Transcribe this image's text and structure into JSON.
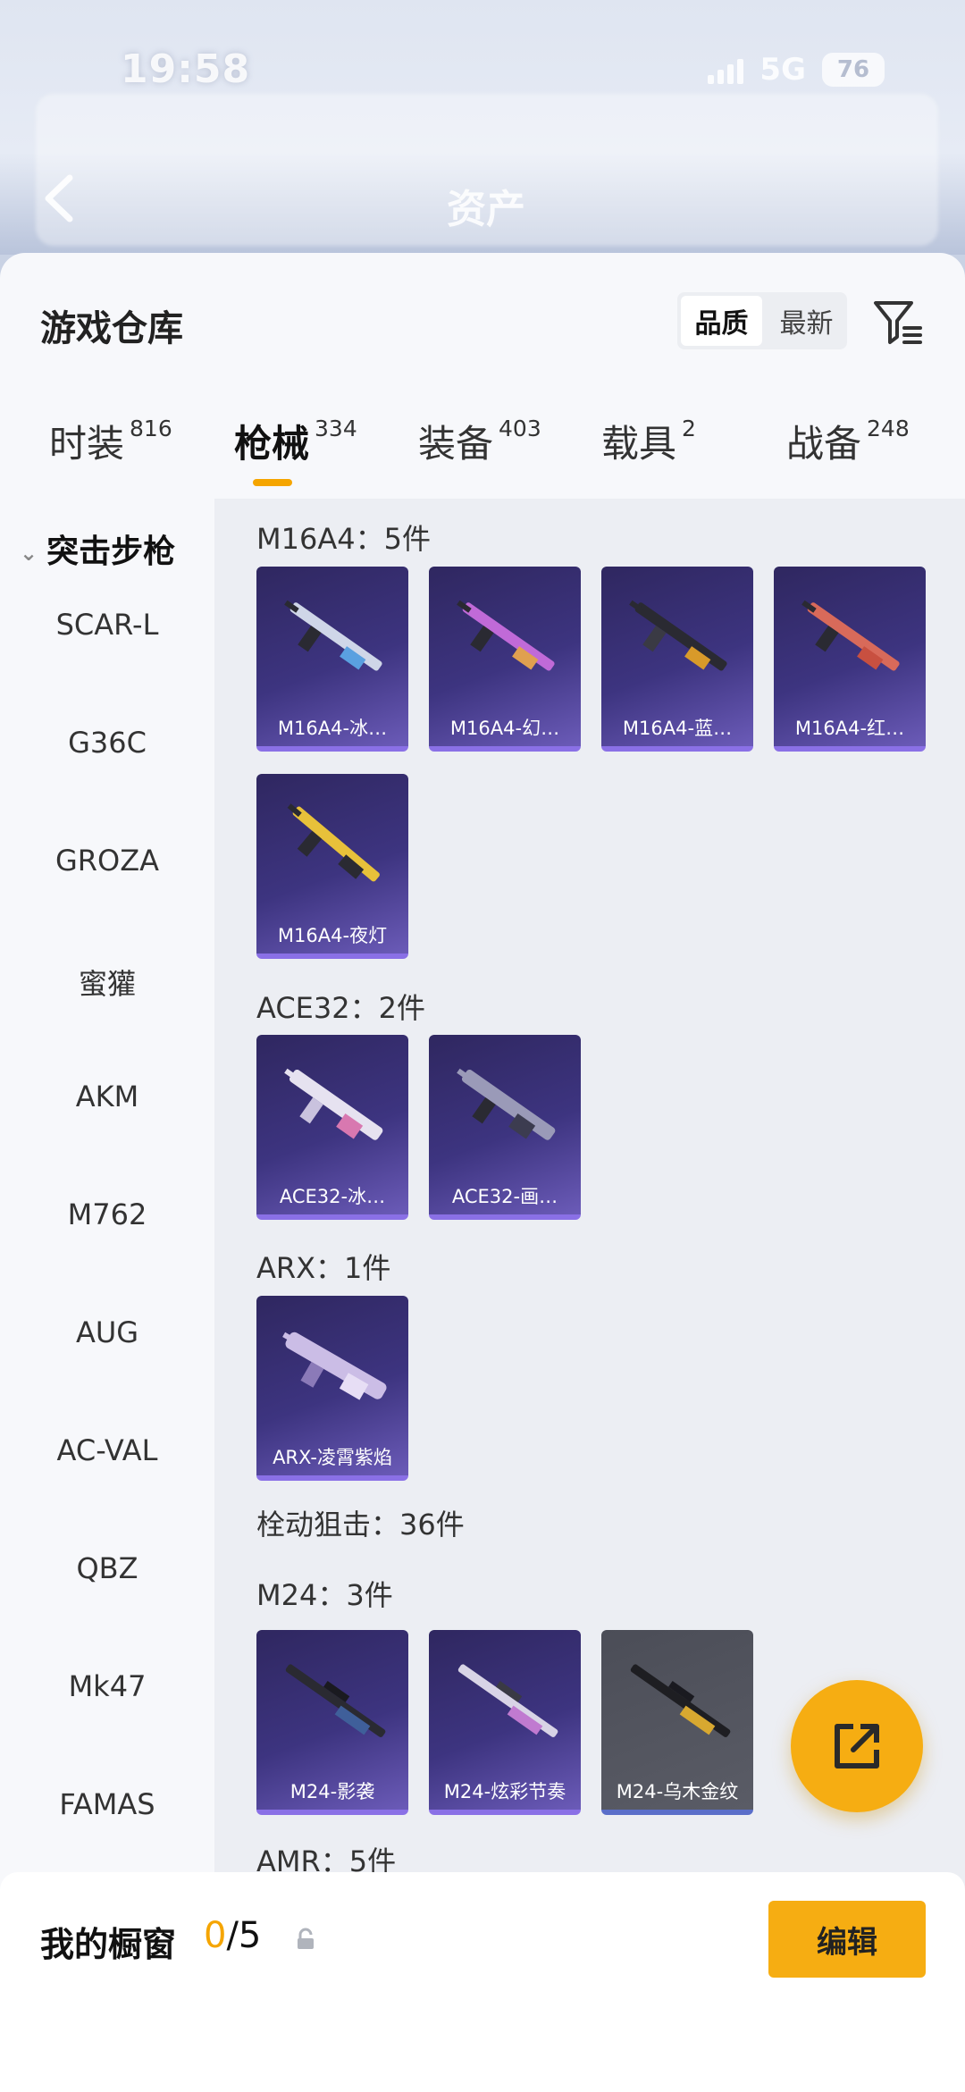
{
  "status": {
    "time": "19:58",
    "network": "5G",
    "battery": "76"
  },
  "header": {
    "title": "资产"
  },
  "panel": {
    "title": "游戏仓库",
    "sort": {
      "options": [
        "品质",
        "最新"
      ],
      "selected": "品质"
    }
  },
  "tabs": [
    {
      "label": "时装",
      "count": "816"
    },
    {
      "label": "枪械",
      "count": "334"
    },
    {
      "label": "装备",
      "count": "403"
    },
    {
      "label": "载具",
      "count": "2"
    },
    {
      "label": "战备",
      "count": "248"
    }
  ],
  "sidebar": {
    "items": [
      "突击步枪",
      "SCAR-L",
      "G36C",
      "GROZA",
      "蜜獾",
      "AKM",
      "M762",
      "AUG",
      "AC-VAL",
      "QBZ",
      "Mk47",
      "FAMAS"
    ]
  },
  "content": {
    "groups": [
      {
        "title": "M16A4：5件",
        "items": [
          "M16A4-冰…",
          "M16A4-幻…",
          "M16A4-蓝…",
          "M16A4-红…",
          "M16A4-夜灯"
        ]
      },
      {
        "title": "ACE32：2件",
        "items": [
          "ACE32-冰…",
          "ACE32-画…"
        ]
      },
      {
        "title": "ARX：1件",
        "items": [
          "ARX-凌霄紫焰"
        ]
      },
      {
        "title": "栓动狙击：36件",
        "items": []
      },
      {
        "title": "M24：3件",
        "items": [
          "M24-影袭",
          "M24-炫彩节奏",
          "M24-乌木金纹"
        ]
      },
      {
        "title": "AMR：5件",
        "items": []
      }
    ]
  },
  "bottom": {
    "showcase_label": "我的橱窗",
    "showcase_used": "0",
    "showcase_total": "/5",
    "edit_label": "编辑"
  },
  "colors": {
    "accent": "#f6ad12",
    "card_purple": "#3d3480",
    "card_gray": "#55575f"
  },
  "icons": [
    "back-icon",
    "filter-icon",
    "chevron-down-icon",
    "lock-icon",
    "share-icon",
    "rifle-icon"
  ]
}
